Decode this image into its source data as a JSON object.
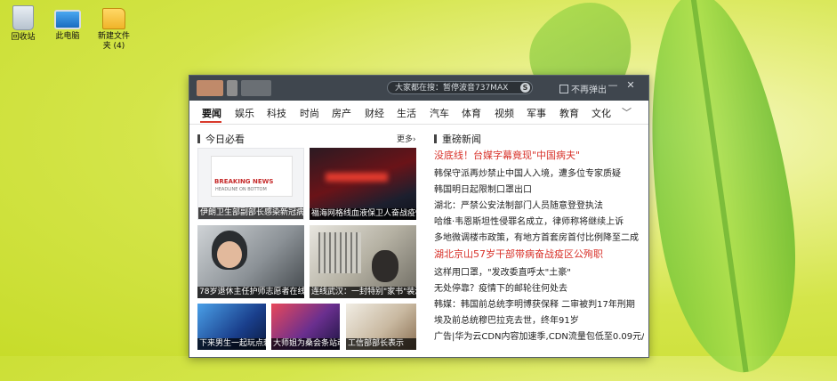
{
  "desktop": {
    "icons": [
      {
        "label": "回收站",
        "icon": "recycle-bin-icon"
      },
      {
        "label": "此电脑",
        "icon": "computer-icon"
      },
      {
        "label": "新建文件夹 (4)",
        "icon": "folder-icon"
      }
    ]
  },
  "window": {
    "search_placeholder": "大家都在搜：暂停波音737MAX",
    "no_show_label": "不再弹出",
    "no_show_checked": false,
    "minimize": "—",
    "close": "✕",
    "nav": [
      "要闻",
      "娱乐",
      "科技",
      "时尚",
      "房产",
      "财经",
      "生活",
      "汽车",
      "体育",
      "视频",
      "军事",
      "教育",
      "文化"
    ],
    "nav_more_icon": "chevron-down-icon",
    "left_section": {
      "title": "今日必看",
      "more": "更多›"
    },
    "tiles": [
      {
        "caption": "伊朗卫生部副部长感染新冠病毒",
        "headline": "BREAKING NEWS",
        "sub": "HEADLINE ON BOTTOM"
      },
      {
        "caption": "福海网格线血液保卫人奋战疫情"
      },
      {
        "caption": "78岁退休主任护师志愿者在线"
      },
      {
        "caption": "连线武汉：一封特别\"家书\"装满"
      },
      {
        "caption": "下来男生一起玩点刺"
      },
      {
        "caption": "大师姐为桑会条站动…"
      },
      {
        "caption": "工信部部长表示"
      }
    ],
    "right_section": {
      "title": "重磅新闻"
    },
    "news": [
      {
        "text": "没底线！台媒字幕竟现\"中国病夫\"",
        "highlight": true
      },
      {
        "text": "韩保守派再炒禁止中国人入境，遭多位专家质疑",
        "highlight": false
      },
      {
        "text": "韩国明日起限制口罩出口",
        "highlight": false
      },
      {
        "text": "湖北：严禁公安法制部门人员随意登登执法",
        "highlight": false
      },
      {
        "text": "哈维·韦恩斯坦性侵罪名成立，律师称将继续上诉",
        "highlight": false
      },
      {
        "text": "多地微调楼市政策，有地方首套房首付比例降至二成",
        "highlight": false
      },
      {
        "text": "湖北京山57岁干部带病奋战疫区公殉职",
        "highlight": true
      },
      {
        "text": "这样用口罩，\"发改委直呼太\"土豪\"",
        "highlight": false
      },
      {
        "text": "无处停靠？疫情下的邮轮往何处去",
        "highlight": false
      },
      {
        "text": "韩媒：韩国前总统李明博获保释 二审被判17年刑期",
        "highlight": false
      },
      {
        "text": "埃及前总统穆巴拉克去世，终年91岁",
        "highlight": false
      },
      {
        "text": "广告|华为云CDN内容加速季,CDN流量包低至0.09元/...",
        "highlight": false
      }
    ]
  }
}
